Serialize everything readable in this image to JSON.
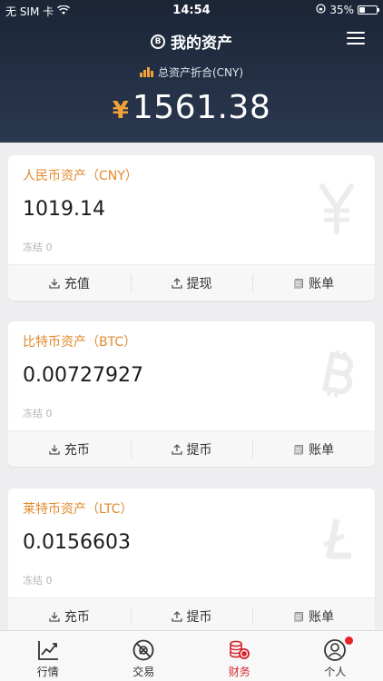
{
  "status_bar": {
    "carrier": "无 SIM 卡",
    "time": "14:54",
    "battery": "35%",
    "battery_level": 0.35
  },
  "header": {
    "title": "我的资产",
    "subtitle": "总资产折合(CNY)",
    "currency_symbol": "¥",
    "total": "1561.38"
  },
  "assets": [
    {
      "title": "人民币资产（CNY）",
      "amount": "1019.14",
      "frozen": "冻结 0",
      "watermark": "yuan-icon",
      "actions": [
        "充值",
        "提现",
        "账单"
      ]
    },
    {
      "title": "比特币资产（BTC）",
      "amount": "0.00727927",
      "frozen": "冻结 0",
      "watermark": "bitcoin-icon",
      "actions": [
        "充币",
        "提币",
        "账单"
      ]
    },
    {
      "title": "莱特币资产（LTC）",
      "amount": "0.0156603",
      "frozen": "冻结 0",
      "watermark": "litecoin-icon",
      "actions": [
        "充币",
        "提币",
        "账单"
      ]
    }
  ],
  "tabbar": {
    "items": [
      {
        "label": "行情",
        "icon": "chart-icon"
      },
      {
        "label": "交易",
        "icon": "compass-icon"
      },
      {
        "label": "财务",
        "icon": "coins-icon",
        "active": true
      },
      {
        "label": "个人",
        "icon": "user-icon",
        "badge": true
      }
    ]
  },
  "colors": {
    "accent": "#f4a237",
    "title_orange": "#e08a2b",
    "active_tab": "#d6262d",
    "header_bg": "#1f2a3d"
  }
}
